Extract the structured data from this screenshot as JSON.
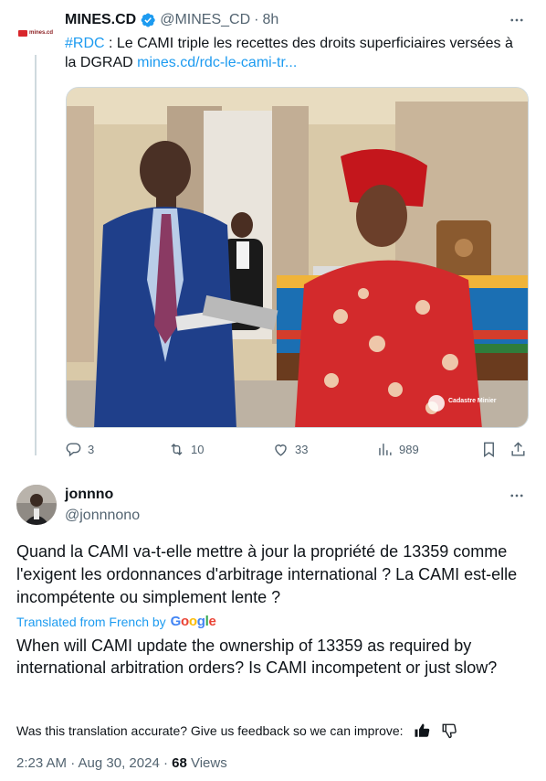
{
  "parent_tweet": {
    "account_name": "MINES.CD",
    "handle": "@MINES_CD",
    "separator": "·",
    "time": "8h",
    "hashtag": "#RDC",
    "text": " : Le CAMI triple les recettes des droits superficiaires versées à la DGRAD ",
    "link": "mines.cd/rdc-le-cami-tr...",
    "avatar_logo_text": "mines.cd",
    "photo_watermark": "Cadastre Minier",
    "stats": {
      "replies": "3",
      "reposts": "10",
      "likes": "33",
      "views": "989"
    }
  },
  "reply_tweet": {
    "display_name": "jonnno",
    "handle": "@jonnnono",
    "original_text": "Quand la CAMI va-t-elle mettre à jour la propriété de 13359 comme l'exigent les ordonnances d'arbitrage international ? La CAMI est-elle incompétente ou simplement lente ?",
    "translated_label": "Translated from French by",
    "translator_brand": "Google",
    "translated_text": "When will CAMI update the ownership of 13359 as required by international arbitration orders? Is CAMI incompetent or just slow?",
    "feedback_prompt": "Was this translation accurate? Give us feedback so we can improve:",
    "timestamp": "2:23 AM · Aug 30, 2024 · ",
    "views_count": "68",
    "views_label": " Views"
  },
  "colors": {
    "accent": "#1d9bf0",
    "text_primary": "#0f1419",
    "text_secondary": "#536471",
    "divider": "#cfd9de"
  },
  "icons": [
    "more-icon",
    "verified-badge-icon",
    "reply-icon",
    "repost-icon",
    "like-icon",
    "views-icon",
    "bookmark-icon",
    "share-icon",
    "thumbs-up-icon",
    "thumbs-down-icon"
  ]
}
